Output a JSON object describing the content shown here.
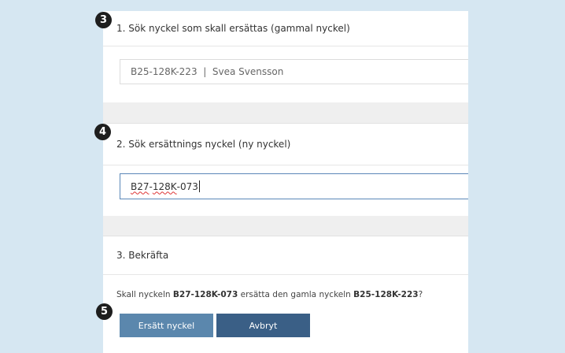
{
  "steps": {
    "step1": {
      "badge": "3",
      "title": "1. Sök nyckel som skall ersättas (gammal nyckel)",
      "field_value": "B25-128K-223  |  Svea Svensson"
    },
    "step2": {
      "badge": "4",
      "title": "2. Sök ersättnings nyckel (ny nyckel)",
      "field_value_part1": "B27",
      "field_value_part2": "-",
      "field_value_part3": "128K",
      "field_value_part4": "-073"
    },
    "step3": {
      "title": "3. Bekräfta",
      "confirm_prefix": "Skall nyckeln ",
      "new_key": "B27-128K-073",
      "confirm_middle": " ersätta den gamla nyckeln ",
      "old_key": "B25-128K-223",
      "confirm_suffix": "?",
      "actions_badge": "5",
      "replace_button": "Ersätt nyckel",
      "cancel_button": "Avbryt"
    }
  },
  "colors": {
    "background": "#d6e7f2",
    "primary_button": "#5b87ad",
    "secondary_button": "#3a5f86",
    "badge": "#1e1e1e"
  }
}
